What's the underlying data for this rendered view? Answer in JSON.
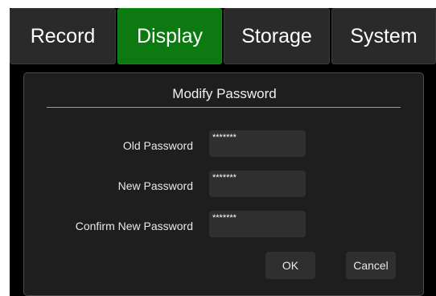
{
  "tabs": [
    {
      "label": "Record",
      "active": false
    },
    {
      "label": "Display",
      "active": true
    },
    {
      "label": "Storage",
      "active": false
    },
    {
      "label": "System",
      "active": false
    }
  ],
  "dialog": {
    "title": "Modify Password",
    "fields": [
      {
        "label": "Old Password",
        "value": "*******"
      },
      {
        "label": "New Password",
        "value": "*******"
      },
      {
        "label": "Confirm New Password",
        "value": "*******"
      }
    ],
    "ok_label": "OK",
    "cancel_label": "Cancel"
  },
  "colors": {
    "active_tab": "#0c7a10",
    "tab": "#2a2a2a",
    "background": "#000000",
    "dialog": "#1e1e1e"
  }
}
